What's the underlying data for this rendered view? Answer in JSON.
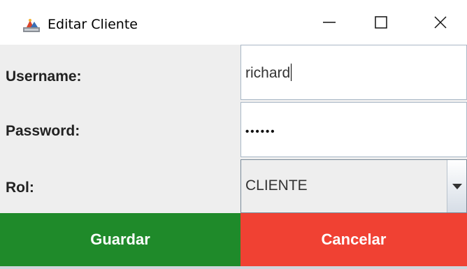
{
  "window": {
    "title": "Editar Cliente",
    "icon": "java-app-icon",
    "controls": [
      "minimize-icon",
      "maximize-icon",
      "close-icon"
    ]
  },
  "form": {
    "username_label": "Username:",
    "username_value": "richard",
    "password_label": "Password:",
    "password_mask": "••••••",
    "rol_label": "Rol:",
    "rol_selected": "CLIENTE"
  },
  "buttons": {
    "save_label": "Guardar",
    "cancel_label": "Cancelar"
  },
  "colors": {
    "save_button": "#1f8a2a",
    "cancel_button": "#f04133",
    "form_background": "#eeeeee"
  }
}
